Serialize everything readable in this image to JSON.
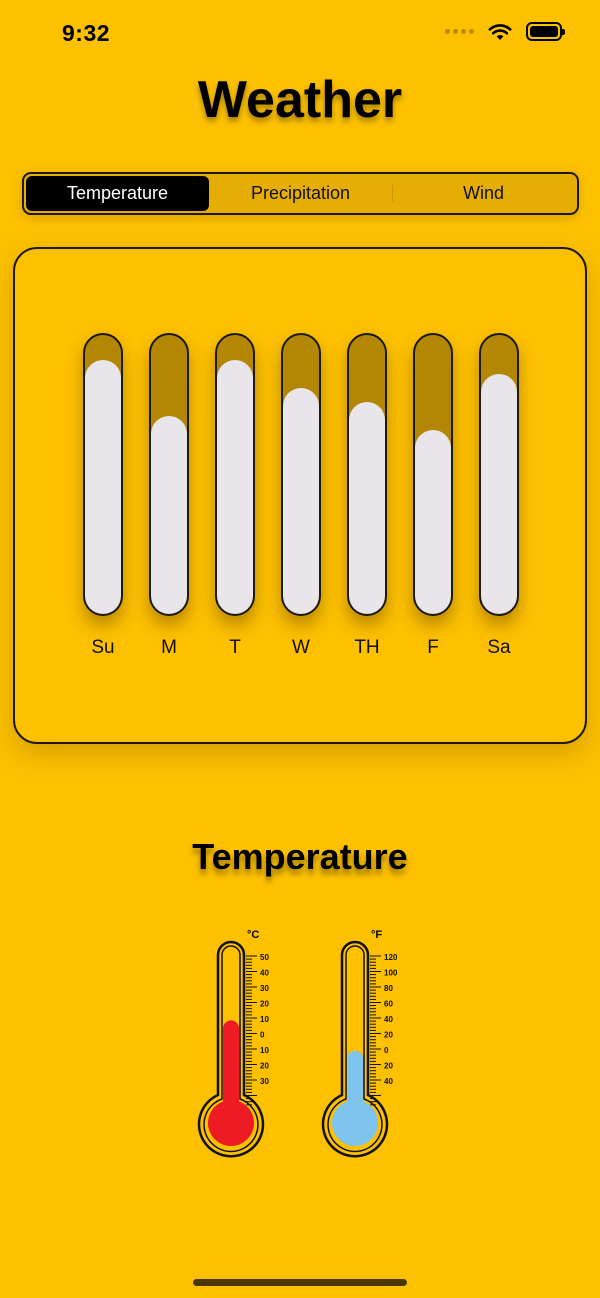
{
  "status_bar": {
    "time": "9:32"
  },
  "app": {
    "title": "Weather"
  },
  "segmented_control": {
    "segments": [
      "Temperature",
      "Precipitation",
      "Wind"
    ],
    "selected": "Temperature"
  },
  "colors": {
    "background": "#FDC101",
    "bar_track": "#B38704",
    "bar_fill": "#E8E6EA",
    "celsius_liquid": "#ED1C24",
    "fahrenheit_liquid": "#7FC4EE"
  },
  "weekly_levels": {
    "days": [
      "Su",
      "M",
      "T",
      "W",
      "TH",
      "F",
      "Sa"
    ],
    "levels": [
      0.91,
      0.71,
      0.91,
      0.81,
      0.76,
      0.66,
      0.86
    ]
  },
  "temperature_section": {
    "title": "Temperature"
  },
  "thermometers": {
    "celsius": {
      "unit": "°C",
      "scale_labels": [
        "50",
        "40",
        "30",
        "20",
        "10",
        "0",
        "10",
        "20",
        "30"
      ],
      "level": 0.56
    },
    "fahrenheit": {
      "unit": "°F",
      "scale_labels": [
        "120",
        "100",
        "80",
        "60",
        "40",
        "20",
        "0",
        "20",
        "40"
      ],
      "level": 0.38
    }
  }
}
